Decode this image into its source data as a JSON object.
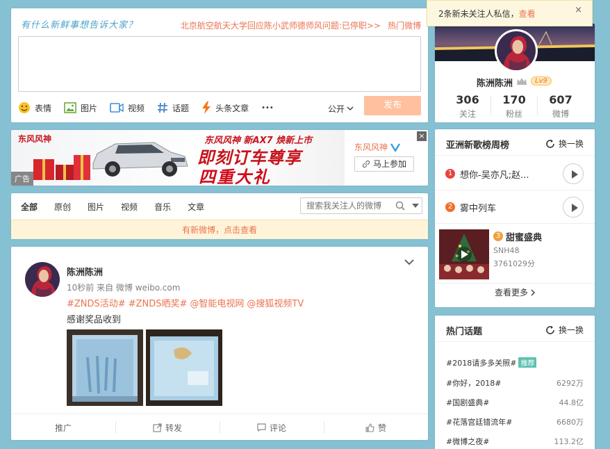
{
  "composer": {
    "prompt": "有什么新鲜事想告诉大家？",
    "hot_link": "北京航空航天大学回应陈小武师德师风问题:已停职>>",
    "hot_label": "热门微博",
    "tools": [
      "表情",
      "图片",
      "视频",
      "话题",
      "头条文章"
    ],
    "more": "•••",
    "visibility": "公开",
    "send": "发布"
  },
  "ad": {
    "brand_logo": "东风风神",
    "slogan_top": "东风风神 新AX7 焕新上市",
    "slogan_main": "即刻订车尊享",
    "slogan_sub": "四重大礼",
    "advertiser": "东风风神",
    "cta": "马上参加",
    "tag": "广告",
    "close": "×"
  },
  "filter": {
    "tabs": [
      "全部",
      "原创",
      "图片",
      "视频",
      "音乐",
      "文章"
    ],
    "search_placeholder": "搜索我关注人的微博",
    "notice": "有新微博，点击查看"
  },
  "post": {
    "author": "陈洲陈洲",
    "meta": "10秒前 来自 微博 weibo.com",
    "tags": [
      "#ZNDS活动#",
      "#ZNDS晒奖#",
      "@智能电视网",
      "@搜狐视频TV"
    ],
    "text": "感谢奖品收到",
    "actions": [
      "推广",
      "转发",
      "评论",
      "赞"
    ]
  },
  "notify": {
    "message": "2条新未关注人私信，",
    "link": "查看",
    "close": "×"
  },
  "profile": {
    "name": "陈洲陈洲",
    "level": "Lv9",
    "stats": [
      {
        "value": "306",
        "label": "关注"
      },
      {
        "value": "170",
        "label": "粉丝"
      },
      {
        "value": "607",
        "label": "微博"
      }
    ]
  },
  "music": {
    "title": "亚洲新歌榜周榜",
    "refresh": "换一换",
    "songs": [
      {
        "rank": "1",
        "title": "想你-吴亦凡;赵..."
      },
      {
        "rank": "2",
        "title": "雾中列车"
      }
    ],
    "featured": {
      "rank": "3",
      "title": "甜蜜盛典",
      "artist": "SNH48",
      "score": "3761029分"
    },
    "view_more": "查看更多",
    "colors": {
      "rank1": "#e8443c",
      "rank2": "#f36e2b",
      "rank3": "#f29f3b"
    }
  },
  "topics": {
    "title": "热门话题",
    "refresh": "换一换",
    "items": [
      {
        "name": "#2018请多多关照#",
        "badge": "推荐",
        "count": ""
      },
      {
        "name": "#你好，2018#",
        "badge": "",
        "count": "6292万"
      },
      {
        "name": "#国剧盛典#",
        "badge": "",
        "count": "44.8亿"
      },
      {
        "name": "#花落宫廷错流年#",
        "badge": "",
        "count": "6680万"
      },
      {
        "name": "#微博之夜#",
        "badge": "",
        "count": "113.2亿"
      }
    ]
  }
}
